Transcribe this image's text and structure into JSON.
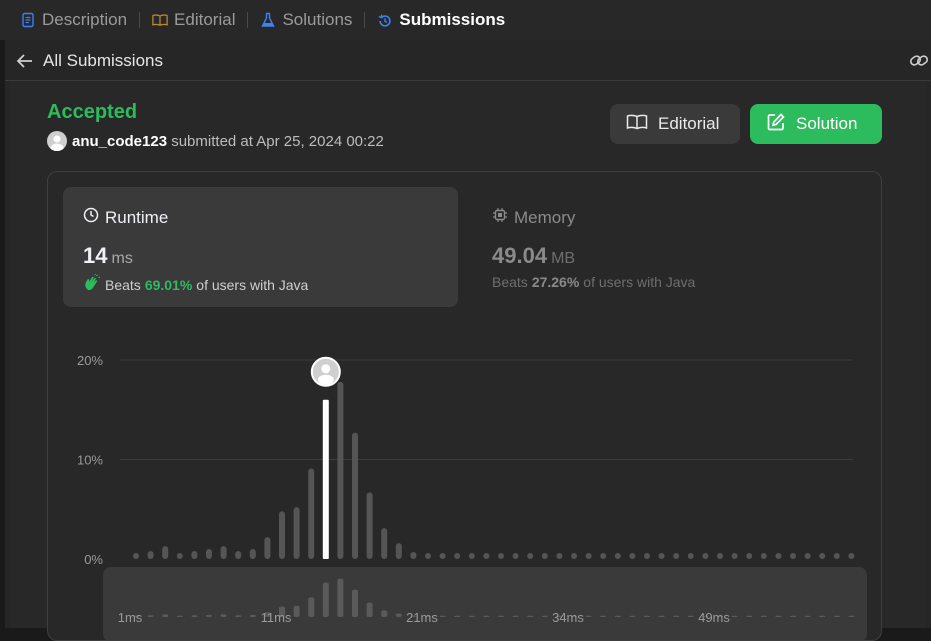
{
  "tabs": [
    {
      "label": "Description",
      "icon": "document-icon",
      "color": "#3b82f6"
    },
    {
      "label": "Editorial",
      "icon": "book-icon",
      "color": "#c08a2e"
    },
    {
      "label": "Solutions",
      "icon": "flask-icon",
      "color": "#3b82f6"
    },
    {
      "label": "Submissions",
      "icon": "history-icon",
      "color": "#3b82f6"
    }
  ],
  "subheader": {
    "back_label": "All Submissions"
  },
  "submission": {
    "status": "Accepted",
    "user": "anu_code123",
    "submitted_text": "submitted at Apr 25, 2024 00:22"
  },
  "buttons": {
    "editorial": "Editorial",
    "solution": "Solution"
  },
  "runtime": {
    "label": "Runtime",
    "value": "14",
    "unit": "ms",
    "beats_prefix": "Beats",
    "beats_pct": "69.01%",
    "beats_suffix": "of users with Java"
  },
  "memory": {
    "label": "Memory",
    "value": "49.04",
    "unit": "MB",
    "beats_prefix": "Beats",
    "beats_pct": "27.26%",
    "beats_suffix": "of users with Java"
  },
  "colors": {
    "accent_green": "#2cbb5d",
    "bar": "#555555",
    "highlight_bar": "#ffffff"
  },
  "chart_data": {
    "type": "bar",
    "ylim": [
      0,
      20
    ],
    "yticks": [
      "0%",
      "10%",
      "20%"
    ],
    "xtick_labels": [
      "1ms",
      "11ms",
      "21ms",
      "34ms",
      "49ms"
    ],
    "xtick_index": [
      0,
      10,
      20,
      30,
      40
    ],
    "highlight_index": 13,
    "values": [
      0.6,
      0.8,
      1.3,
      0.6,
      0.8,
      1.0,
      1.3,
      0.8,
      1.0,
      2.2,
      4.8,
      5.2,
      9.1,
      16.0,
      17.8,
      12.7,
      6.7,
      3.1,
      1.6,
      0.7,
      0.6,
      0.6,
      0.6,
      0.6,
      0.6,
      0.6,
      0.6,
      0.6,
      0.6,
      0.6,
      0.6,
      0.6,
      0.6,
      0.6,
      0.6,
      0.6,
      0.6,
      0.6,
      0.6,
      0.6,
      0.6,
      0.6,
      0.6,
      0.6,
      0.6,
      0.6,
      0.6,
      0.6,
      0.6,
      0.6
    ]
  }
}
